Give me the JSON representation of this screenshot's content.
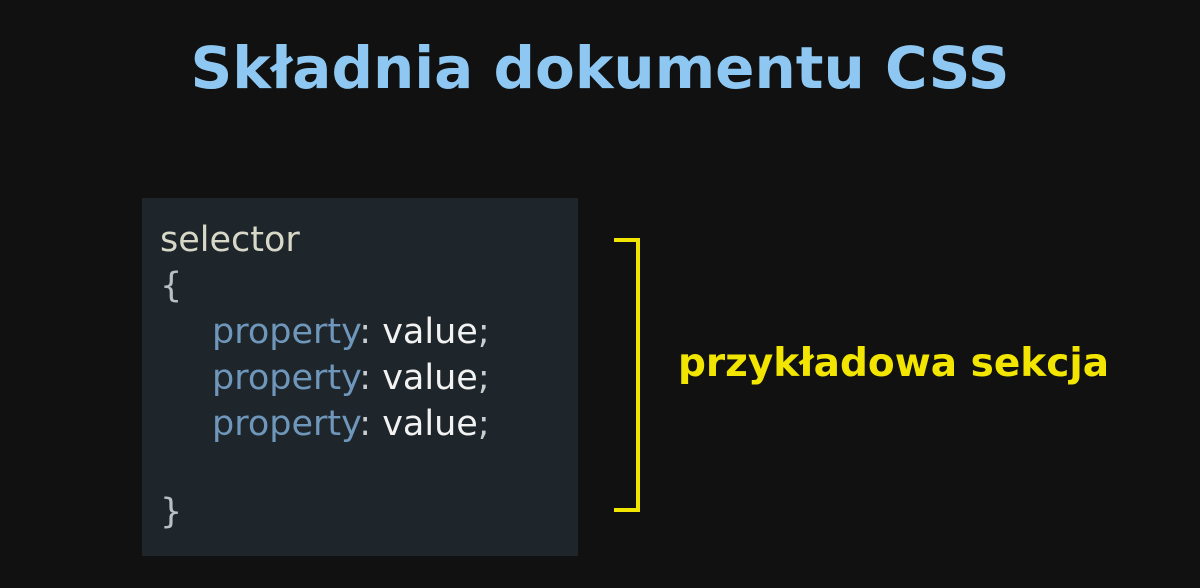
{
  "title": "Składnia dokumentu CSS",
  "code": {
    "selector": "selector",
    "open_brace": "{",
    "close_brace": "}",
    "declarations": [
      {
        "property": "property",
        "colon": ":",
        "value": " value",
        "semicolon": ";"
      },
      {
        "property": "property",
        "colon": ":",
        "value": " value",
        "semicolon": ";"
      },
      {
        "property": "property",
        "colon": ":",
        "value": " value",
        "semicolon": ";"
      }
    ]
  },
  "annotation": {
    "label": "przykładowa sekcja"
  },
  "colors": {
    "title": "#8ec8f2",
    "code_background": "#1e262b",
    "selector": "#d8d8c8",
    "braces": "#b8c0c4",
    "property": "#6f96bb",
    "punctuation": "#c8cdd0",
    "value": "#f2f2f2",
    "annotation": "#f2e600"
  }
}
